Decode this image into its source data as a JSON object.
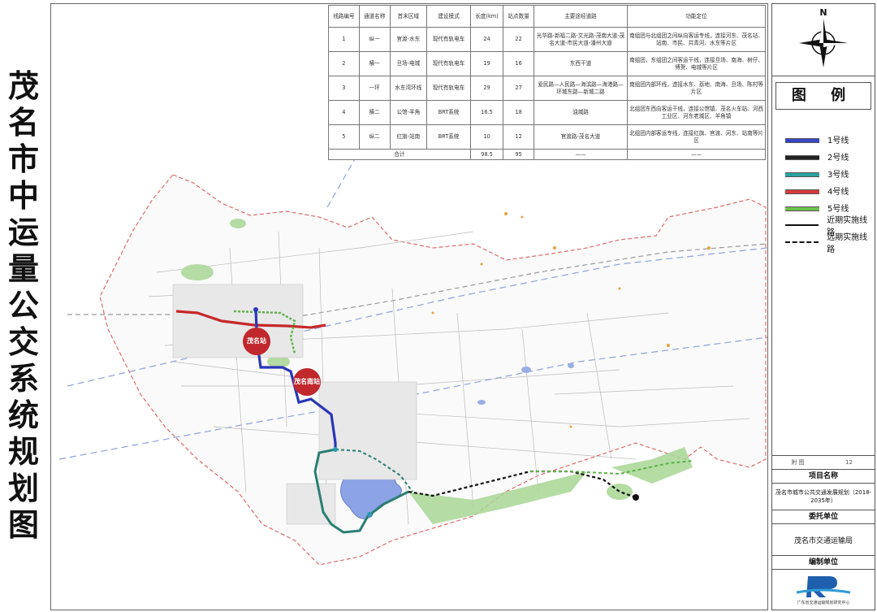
{
  "title_chars": [
    "茂",
    "名",
    "市",
    "中",
    "运",
    "量",
    "公",
    "交",
    "系",
    "统",
    "规",
    "划",
    "图"
  ],
  "table": {
    "headers": [
      "线路编号",
      "通道名称",
      "首末区域",
      "建设模式",
      "长度(km)",
      "站点数量",
      "主要途经道路",
      "功能定位"
    ],
    "rows": [
      {
        "no": "1",
        "name": "纵一",
        "area": "官渡-水东",
        "mode": "现代有轨电车",
        "length": "24",
        "stations": "22",
        "roads": "光华路-新福二路-文光路-茂南大道-茂名大道-市民大道-潘州大道",
        "function": "南组团与北组团之间纵向客运专线，连接河东、茂名站、站南、市民、共青河、水东等片区"
      },
      {
        "no": "2",
        "name": "横一",
        "area": "旦场-电城",
        "mode": "现代有轨电车",
        "length": "19",
        "stations": "16",
        "roads": "东西干道",
        "function": "南组团，东组团之间客运干线，连接旦场、南海、树仔、博贺、电城等片区"
      },
      {
        "no": "3",
        "name": "一环",
        "area": "水东湾环线",
        "mode": "现代有轨电车",
        "length": "29",
        "stations": "27",
        "roads": "爱民路—人民路—海滨路—海港路—环城东路—新城二路",
        "function": "南组团内部环线，连接水东、荔地、南海、旦场、陈村等片区"
      },
      {
        "no": "4",
        "name": "横二",
        "area": "公馆-羊角",
        "mode": "BRT系统",
        "length": "16.5",
        "stations": "18",
        "roads": "油城路",
        "function": "北组团东西向客运干线，连接公馆镇、茂名火车站、河西工业区、河东老城区、羊角镇"
      },
      {
        "no": "5",
        "name": "纵二",
        "area": "红旗-站南",
        "mode": "BRT系统",
        "length": "10",
        "stations": "12",
        "roads": "官渡路-茂名大道",
        "function": "北组团内部客运专线，连接红旗、官渡、河东、站南等片区"
      }
    ],
    "total": {
      "label": "合计",
      "length": "98.5",
      "stations": "95",
      "roads": "——",
      "function": "——"
    }
  },
  "stations": {
    "maoming": "茂名站",
    "maoming_south": "茂名南站"
  },
  "compass": {
    "north": "N"
  },
  "legend": {
    "title": "图 例",
    "items": [
      {
        "label": "1号线",
        "color": "#3747c6",
        "kind": "line"
      },
      {
        "label": "2号线",
        "color": "#222222",
        "kind": "line"
      },
      {
        "label": "3号线",
        "color": "#2aa3a0",
        "kind": "line"
      },
      {
        "label": "4号线",
        "color": "#d63b3b",
        "kind": "line"
      },
      {
        "label": "5号线",
        "color": "#6dc04d",
        "kind": "line"
      },
      {
        "label": "近期实施线路",
        "kind": "solid"
      },
      {
        "label": "远期实施线路",
        "kind": "dashed"
      }
    ]
  },
  "info": {
    "fig_label": "附  图",
    "fig_no": "12",
    "project_header": "项目名称",
    "project_name": "茂名市城市公共交通发展规划（2018-2035年）",
    "client_header": "委托单位",
    "client": "茂名市交通运输局",
    "author_header": "编制单位",
    "author": "广东省交通运输规划研究中心"
  },
  "colors": {
    "line1": "#2b36b8",
    "line2": "#111111",
    "line3": "#2a7f73",
    "line4": "#c62828",
    "line5": "#5fb04a",
    "boundary": "#e06060",
    "water": "#8ca3e6",
    "green": "#9fcf87"
  }
}
